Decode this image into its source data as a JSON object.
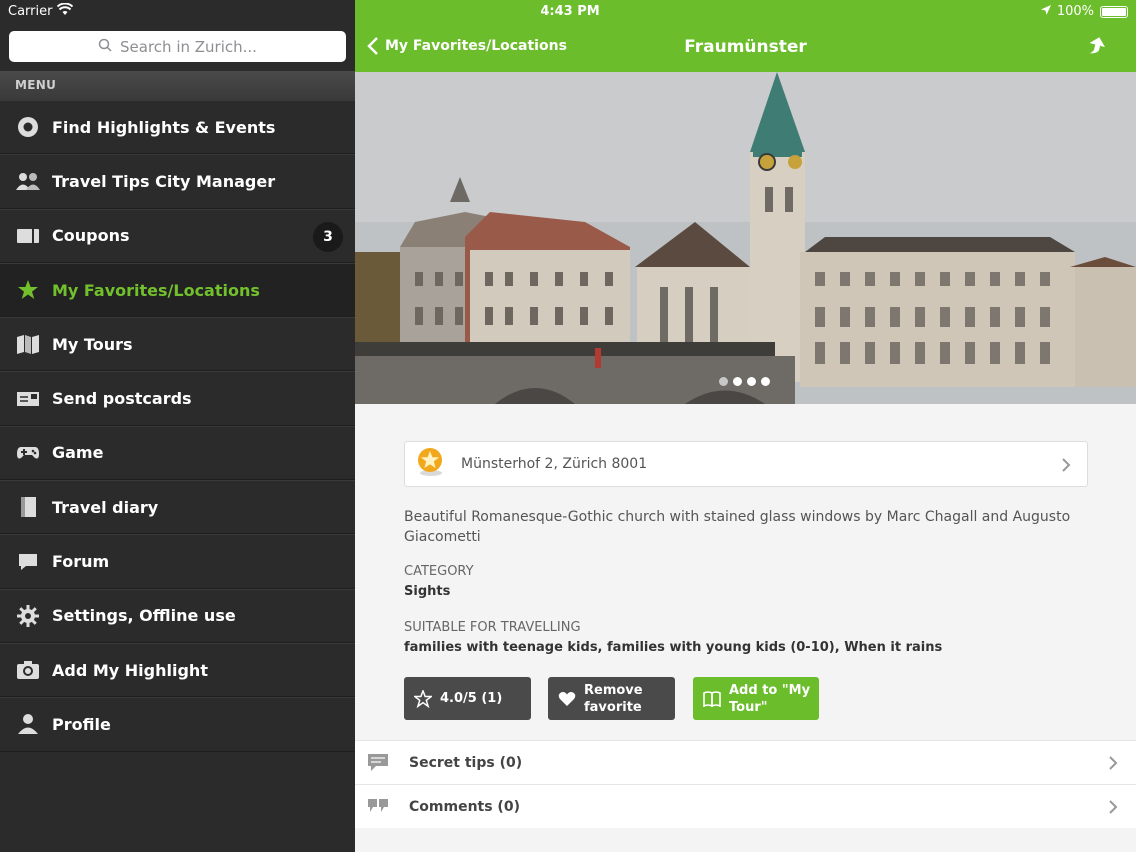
{
  "status_bar": {
    "carrier": "Carrier",
    "time": "4:43 PM",
    "battery": "100%"
  },
  "sidebar": {
    "search_placeholder": "Search in Zurich...",
    "menu_header": "MENU",
    "items": [
      {
        "label": "Find Highlights & Events",
        "icon": "target-icon"
      },
      {
        "label": "Travel Tips City Manager",
        "icon": "people-icon"
      },
      {
        "label": "Coupons",
        "icon": "coupon-icon",
        "badge": "3"
      },
      {
        "label": "My Favorites/Locations",
        "icon": "star-icon",
        "active": true
      },
      {
        "label": "My Tours",
        "icon": "map-icon"
      },
      {
        "label": "Send postcards",
        "icon": "postcard-icon"
      },
      {
        "label": "Game",
        "icon": "gamepad-icon"
      },
      {
        "label": "Travel diary",
        "icon": "diary-icon"
      },
      {
        "label": "Forum",
        "icon": "chat-icon"
      },
      {
        "label": "Settings, Offline use",
        "icon": "gear-icon"
      },
      {
        "label": "Add My Highlight",
        "icon": "camera-icon"
      },
      {
        "label": "Profile",
        "icon": "person-icon"
      }
    ]
  },
  "navbar": {
    "back_label": "My Favorites/Locations",
    "title": "Fraumünster"
  },
  "photo": {
    "pages": 4,
    "current_page": 2
  },
  "detail": {
    "address": "Münsterhof 2, Zürich 8001",
    "description": "Beautiful Romanesque-Gothic church with stained glass windows by Marc Chagall and Augusto Giacometti",
    "category_label": "CATEGORY",
    "category_value": "Sights",
    "suitable_label": "SUITABLE FOR TRAVELLING",
    "suitable_value": "families with teenage kids, families with young kids (0-10), When it rains"
  },
  "actions": {
    "rating": "4.0/5 (1)",
    "remove_favorite_line1": "Remove",
    "remove_favorite_line2": "favorite",
    "add_tour_line1": "Add to \"My",
    "add_tour_line2": "Tour\""
  },
  "rows": {
    "secret_tips": "Secret tips (0)",
    "comments": "Comments (0)"
  },
  "colors": {
    "accent_green": "#6cbd2c",
    "sidebar_bg": "#2b2b2b",
    "button_dark": "#4a4a4a"
  }
}
